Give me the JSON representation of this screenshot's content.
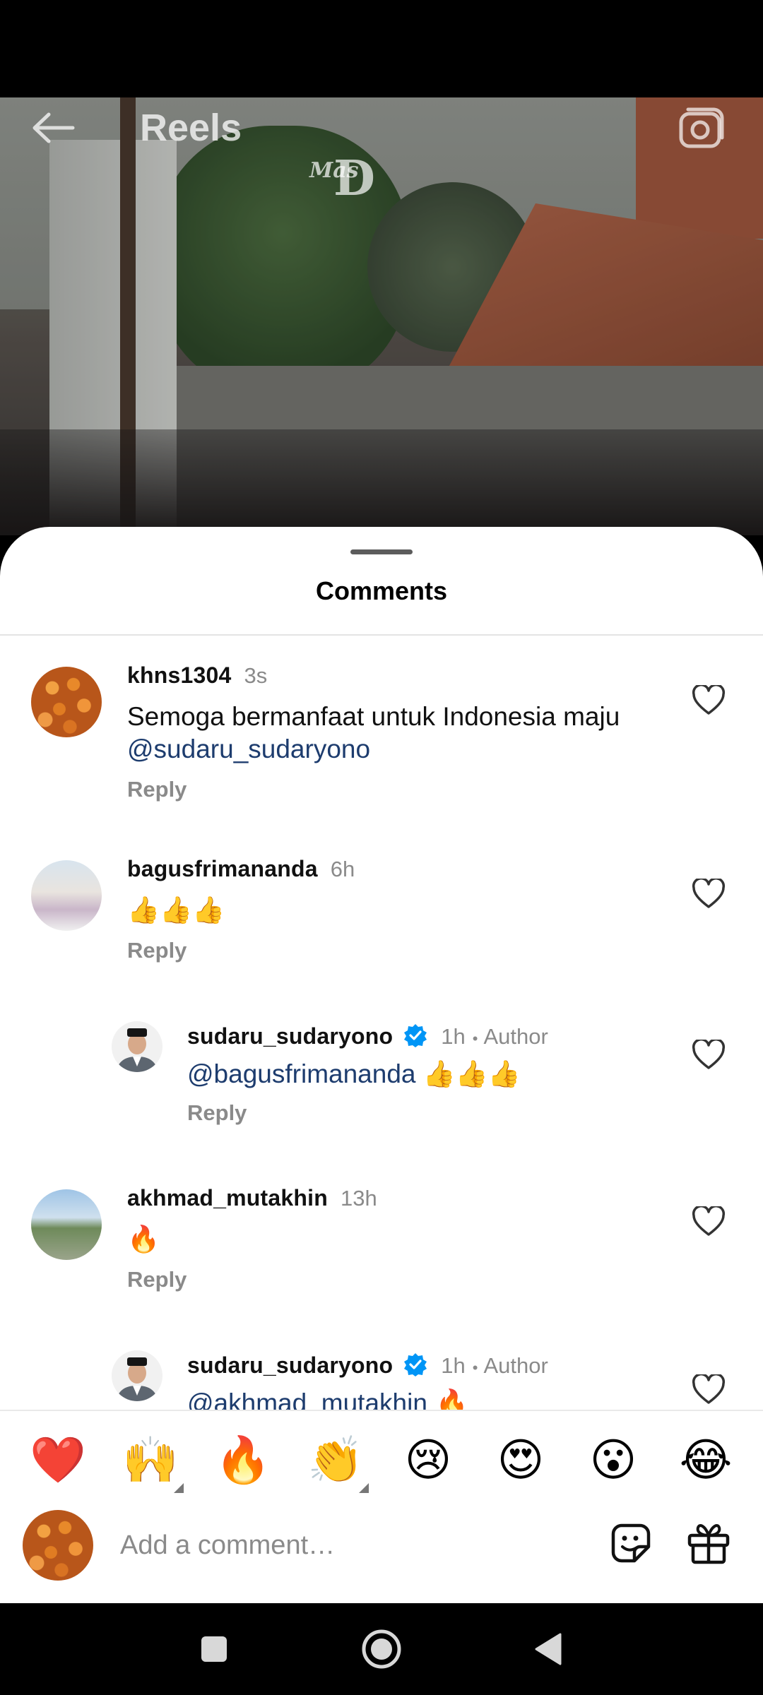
{
  "header": {
    "title": "Reels",
    "watermark_small": "Mas",
    "watermark_big": "D"
  },
  "sheet": {
    "title": "Comments"
  },
  "comments": [
    {
      "username": "khns1304",
      "time": "3s",
      "text": "Semoga bermanfaat untuk Indonesia maju",
      "mention": "@sudaru_sudaryono",
      "reply_label": "Reply",
      "avatar": "oranges-avatar"
    },
    {
      "username": "bagusfrimananda",
      "time": "6h",
      "text": "👍👍👍",
      "reply_label": "Reply",
      "avatar": "family-avatar"
    },
    {
      "username": "sudaru_sudaryono",
      "time": "1h",
      "author_label": "Author",
      "mention": "@bagusfrimananda",
      "text": " 👍👍👍",
      "reply_label": "Reply",
      "verified": true,
      "avatar": "man-peci-avatar"
    },
    {
      "username": "akhmad_mutakhin",
      "time": "13h",
      "text": "🔥",
      "reply_label": "Reply",
      "avatar": "landscape-avatar"
    },
    {
      "username": "sudaru_sudaryono",
      "time": "1h",
      "author_label": "Author",
      "mention": "@akhmad_mutakhin",
      "text": " 🔥",
      "verified": true,
      "avatar": "man-peci-avatar"
    }
  ],
  "emoji_bar": [
    "❤️",
    "🙌",
    "🔥",
    "👏",
    "😢",
    "😍",
    "😮",
    "😂"
  ],
  "input": {
    "placeholder": "Add a comment…"
  },
  "colors": {
    "mention": "#1d3c6e",
    "verified": "#0095f6",
    "muted": "#8a8a8a"
  }
}
